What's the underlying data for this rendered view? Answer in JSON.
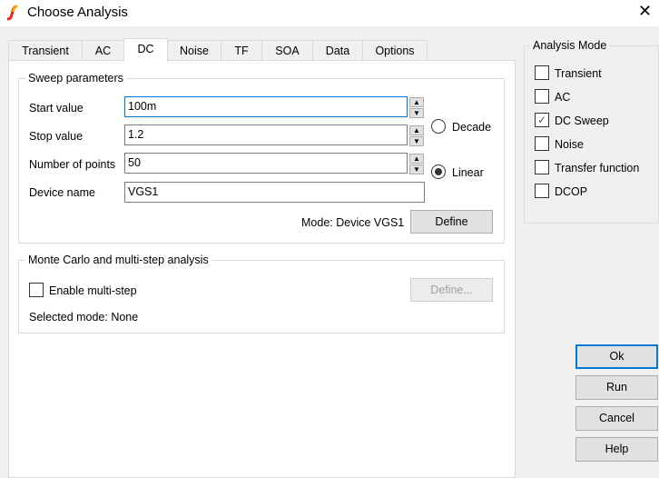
{
  "window": {
    "title": "Choose Analysis",
    "close": "✕"
  },
  "tabs": [
    "Transient",
    "AC",
    "DC",
    "Noise",
    "TF",
    "SOA",
    "Data",
    "Options"
  ],
  "sweep": {
    "title": "Sweep parameters",
    "start_label": "Start value",
    "start_value": "100m",
    "stop_label": "Stop value",
    "stop_value": "1.2",
    "points_label": "Number of points",
    "points_value": "50",
    "device_label": "Device name",
    "device_value": "VGS1",
    "decade": "Decade",
    "linear": "Linear",
    "mode_text": "Mode: Device VGS1",
    "define": "Define"
  },
  "monte": {
    "title": "Monte Carlo and multi-step analysis",
    "enable": "Enable multi-step",
    "define": "Define...",
    "selected": "Selected mode: None"
  },
  "analysis_mode": {
    "title": "Analysis Mode",
    "items": [
      {
        "label": "Transient",
        "checked": false
      },
      {
        "label": "AC",
        "checked": false
      },
      {
        "label": "DC Sweep",
        "checked": true
      },
      {
        "label": "Noise",
        "checked": false
      },
      {
        "label": "Transfer function",
        "checked": false
      },
      {
        "label": "DCOP",
        "checked": false
      }
    ]
  },
  "buttons": {
    "ok": "Ok",
    "run": "Run",
    "cancel": "Cancel",
    "help": "Help"
  }
}
